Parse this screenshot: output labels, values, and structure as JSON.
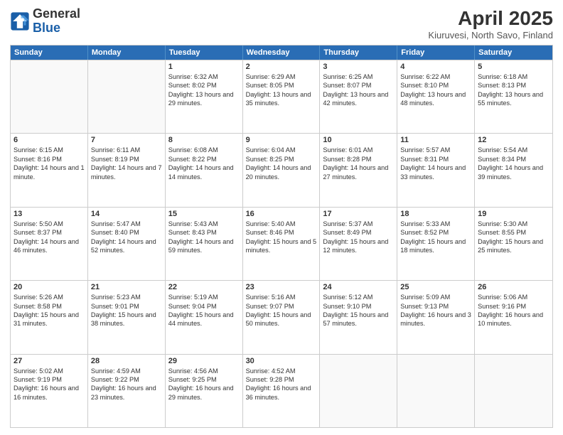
{
  "header": {
    "logo_general": "General",
    "logo_blue": "Blue",
    "title": "April 2025",
    "subtitle": "Kiuruvesi, North Savo, Finland"
  },
  "days_of_week": [
    "Sunday",
    "Monday",
    "Tuesday",
    "Wednesday",
    "Thursday",
    "Friday",
    "Saturday"
  ],
  "weeks": [
    [
      {
        "day": "",
        "empty": true
      },
      {
        "day": "",
        "empty": true
      },
      {
        "day": "1",
        "sunrise": "Sunrise: 6:32 AM",
        "sunset": "Sunset: 8:02 PM",
        "daylight": "Daylight: 13 hours and 29 minutes."
      },
      {
        "day": "2",
        "sunrise": "Sunrise: 6:29 AM",
        "sunset": "Sunset: 8:05 PM",
        "daylight": "Daylight: 13 hours and 35 minutes."
      },
      {
        "day": "3",
        "sunrise": "Sunrise: 6:25 AM",
        "sunset": "Sunset: 8:07 PM",
        "daylight": "Daylight: 13 hours and 42 minutes."
      },
      {
        "day": "4",
        "sunrise": "Sunrise: 6:22 AM",
        "sunset": "Sunset: 8:10 PM",
        "daylight": "Daylight: 13 hours and 48 minutes."
      },
      {
        "day": "5",
        "sunrise": "Sunrise: 6:18 AM",
        "sunset": "Sunset: 8:13 PM",
        "daylight": "Daylight: 13 hours and 55 minutes."
      }
    ],
    [
      {
        "day": "6",
        "sunrise": "Sunrise: 6:15 AM",
        "sunset": "Sunset: 8:16 PM",
        "daylight": "Daylight: 14 hours and 1 minute."
      },
      {
        "day": "7",
        "sunrise": "Sunrise: 6:11 AM",
        "sunset": "Sunset: 8:19 PM",
        "daylight": "Daylight: 14 hours and 7 minutes."
      },
      {
        "day": "8",
        "sunrise": "Sunrise: 6:08 AM",
        "sunset": "Sunset: 8:22 PM",
        "daylight": "Daylight: 14 hours and 14 minutes."
      },
      {
        "day": "9",
        "sunrise": "Sunrise: 6:04 AM",
        "sunset": "Sunset: 8:25 PM",
        "daylight": "Daylight: 14 hours and 20 minutes."
      },
      {
        "day": "10",
        "sunrise": "Sunrise: 6:01 AM",
        "sunset": "Sunset: 8:28 PM",
        "daylight": "Daylight: 14 hours and 27 minutes."
      },
      {
        "day": "11",
        "sunrise": "Sunrise: 5:57 AM",
        "sunset": "Sunset: 8:31 PM",
        "daylight": "Daylight: 14 hours and 33 minutes."
      },
      {
        "day": "12",
        "sunrise": "Sunrise: 5:54 AM",
        "sunset": "Sunset: 8:34 PM",
        "daylight": "Daylight: 14 hours and 39 minutes."
      }
    ],
    [
      {
        "day": "13",
        "sunrise": "Sunrise: 5:50 AM",
        "sunset": "Sunset: 8:37 PM",
        "daylight": "Daylight: 14 hours and 46 minutes."
      },
      {
        "day": "14",
        "sunrise": "Sunrise: 5:47 AM",
        "sunset": "Sunset: 8:40 PM",
        "daylight": "Daylight: 14 hours and 52 minutes."
      },
      {
        "day": "15",
        "sunrise": "Sunrise: 5:43 AM",
        "sunset": "Sunset: 8:43 PM",
        "daylight": "Daylight: 14 hours and 59 minutes."
      },
      {
        "day": "16",
        "sunrise": "Sunrise: 5:40 AM",
        "sunset": "Sunset: 8:46 PM",
        "daylight": "Daylight: 15 hours and 5 minutes."
      },
      {
        "day": "17",
        "sunrise": "Sunrise: 5:37 AM",
        "sunset": "Sunset: 8:49 PM",
        "daylight": "Daylight: 15 hours and 12 minutes."
      },
      {
        "day": "18",
        "sunrise": "Sunrise: 5:33 AM",
        "sunset": "Sunset: 8:52 PM",
        "daylight": "Daylight: 15 hours and 18 minutes."
      },
      {
        "day": "19",
        "sunrise": "Sunrise: 5:30 AM",
        "sunset": "Sunset: 8:55 PM",
        "daylight": "Daylight: 15 hours and 25 minutes."
      }
    ],
    [
      {
        "day": "20",
        "sunrise": "Sunrise: 5:26 AM",
        "sunset": "Sunset: 8:58 PM",
        "daylight": "Daylight: 15 hours and 31 minutes."
      },
      {
        "day": "21",
        "sunrise": "Sunrise: 5:23 AM",
        "sunset": "Sunset: 9:01 PM",
        "daylight": "Daylight: 15 hours and 38 minutes."
      },
      {
        "day": "22",
        "sunrise": "Sunrise: 5:19 AM",
        "sunset": "Sunset: 9:04 PM",
        "daylight": "Daylight: 15 hours and 44 minutes."
      },
      {
        "day": "23",
        "sunrise": "Sunrise: 5:16 AM",
        "sunset": "Sunset: 9:07 PM",
        "daylight": "Daylight: 15 hours and 50 minutes."
      },
      {
        "day": "24",
        "sunrise": "Sunrise: 5:12 AM",
        "sunset": "Sunset: 9:10 PM",
        "daylight": "Daylight: 15 hours and 57 minutes."
      },
      {
        "day": "25",
        "sunrise": "Sunrise: 5:09 AM",
        "sunset": "Sunset: 9:13 PM",
        "daylight": "Daylight: 16 hours and 3 minutes."
      },
      {
        "day": "26",
        "sunrise": "Sunrise: 5:06 AM",
        "sunset": "Sunset: 9:16 PM",
        "daylight": "Daylight: 16 hours and 10 minutes."
      }
    ],
    [
      {
        "day": "27",
        "sunrise": "Sunrise: 5:02 AM",
        "sunset": "Sunset: 9:19 PM",
        "daylight": "Daylight: 16 hours and 16 minutes."
      },
      {
        "day": "28",
        "sunrise": "Sunrise: 4:59 AM",
        "sunset": "Sunset: 9:22 PM",
        "daylight": "Daylight: 16 hours and 23 minutes."
      },
      {
        "day": "29",
        "sunrise": "Sunrise: 4:56 AM",
        "sunset": "Sunset: 9:25 PM",
        "daylight": "Daylight: 16 hours and 29 minutes."
      },
      {
        "day": "30",
        "sunrise": "Sunrise: 4:52 AM",
        "sunset": "Sunset: 9:28 PM",
        "daylight": "Daylight: 16 hours and 36 minutes."
      },
      {
        "day": "",
        "empty": true
      },
      {
        "day": "",
        "empty": true
      },
      {
        "day": "",
        "empty": true
      }
    ]
  ]
}
